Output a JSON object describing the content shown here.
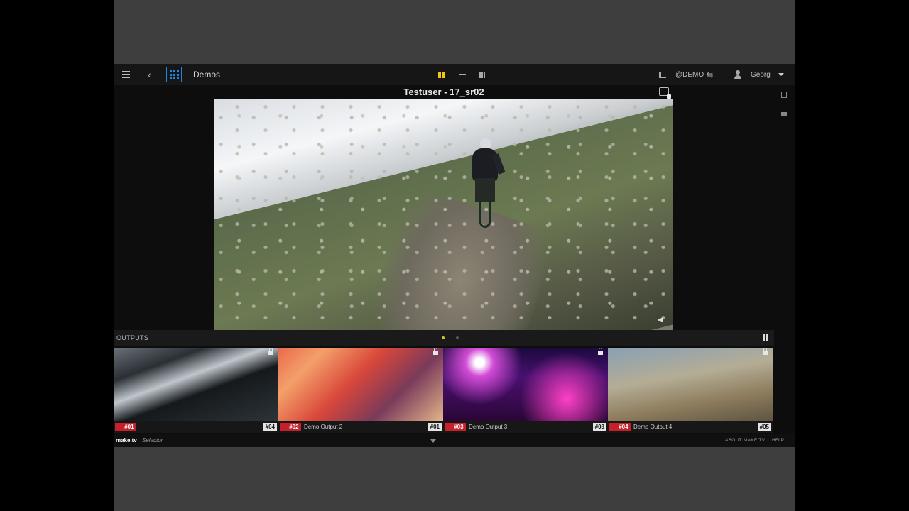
{
  "header": {
    "breadcrumb": "Demos",
    "back_glyph": "‹",
    "organization": "@DEMO",
    "shuffle_glyph": "⇆",
    "user_name": "Georg"
  },
  "viewer": {
    "title": "Testuser - 17_sr02"
  },
  "outputs": {
    "label": "OUTPUTS",
    "tiles": [
      {
        "output": "— #01",
        "name": "",
        "input": "#04"
      },
      {
        "output": "— #02",
        "name": "Demo Output 2",
        "input": "#01"
      },
      {
        "output": "— #03",
        "name": "Demo Output 3",
        "input": "#03"
      },
      {
        "output": "— #04",
        "name": "Demo Output 4",
        "input": "#05"
      }
    ]
  },
  "footer": {
    "logo": "make.tv",
    "product": "Selector",
    "about": "ABOUT MAKE TV",
    "help": "HELP"
  },
  "colors": {
    "accent_blue": "#1e88e5",
    "accent_yellow": "#f0c419",
    "output_red": "#c8202a"
  },
  "icons": [
    "menu-icon",
    "back-icon",
    "apps-grid-icon",
    "grid-view-icon",
    "list-view-icon",
    "map-view-icon",
    "station-icon",
    "shuffle-icon",
    "user-icon",
    "caret-down-icon",
    "snapshot-icon",
    "mute-icon",
    "pause-icon",
    "lock-icon"
  ]
}
